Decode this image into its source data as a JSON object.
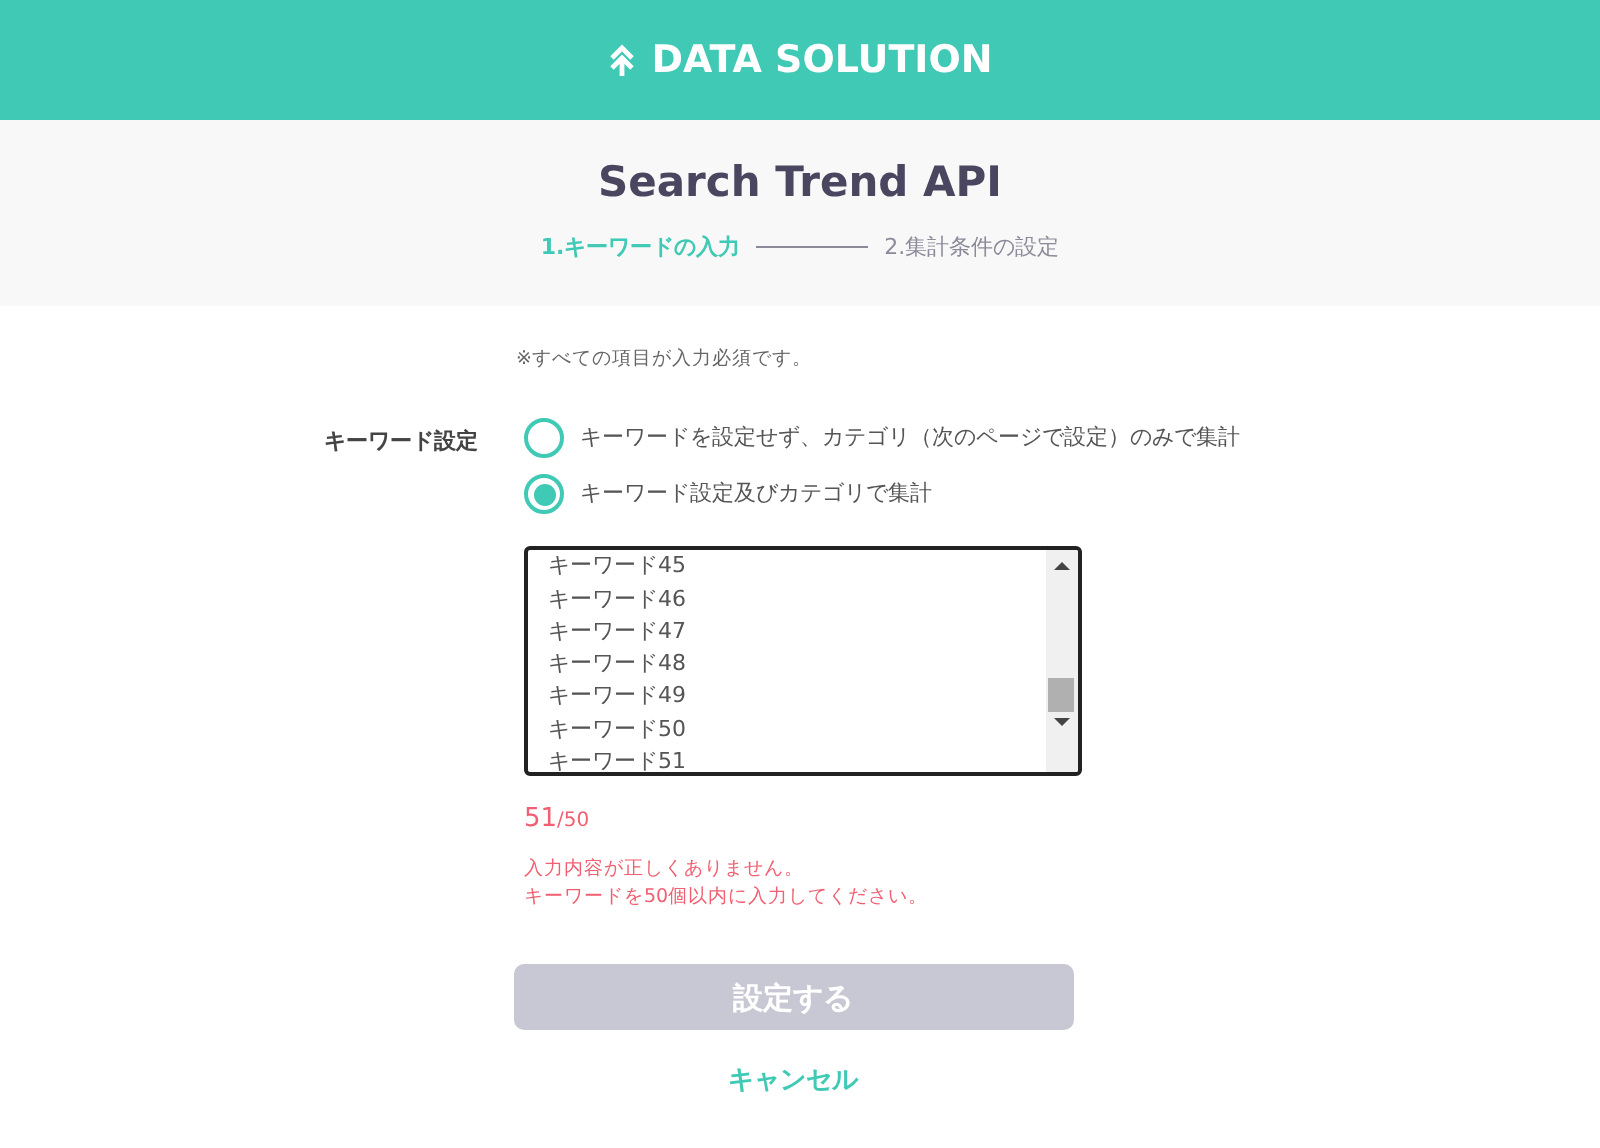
{
  "header": {
    "brand": "DATA SOLUTION"
  },
  "title": "Search Trend API",
  "steps": [
    {
      "label": "1.キーワードの入力",
      "selected": true
    },
    {
      "label": "2.集計条件の設定",
      "selected": false
    }
  ],
  "note": "※すべての項目が入力必須です。",
  "field_label": "キーワード設定",
  "options": [
    {
      "label": "キーワードを設定せず、カテゴリ（次のページで設定）のみで集計",
      "selected": false
    },
    {
      "label": "キーワード設定及びカテゴリで集計",
      "selected": true
    }
  ],
  "keywords": [
    "キーワード45",
    "キーワード46",
    "キーワード47",
    "キーワード48",
    "キーワード49",
    "キーワード50",
    "キーワード51"
  ],
  "counter": {
    "count": "51",
    "limit": "/50"
  },
  "errors": [
    "入力内容が正しくありません。",
    "キーワードを50個以内に入力してください。"
  ],
  "submit": {
    "label": "設定する",
    "disabled": true
  },
  "cancel": "キャンセル"
}
